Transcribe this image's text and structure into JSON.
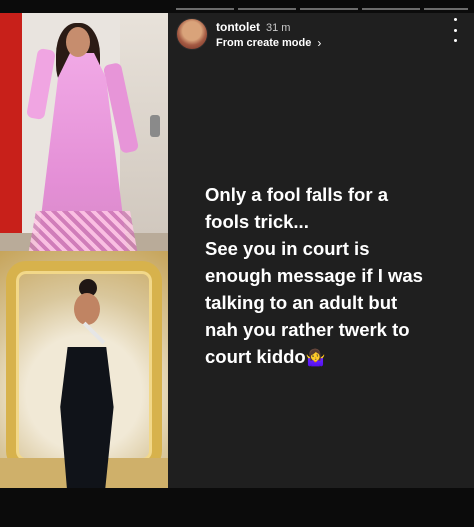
{
  "story": {
    "username": "tontolet",
    "time_ago": "31 m",
    "source_label": "From create mode",
    "source_chevron_icon": "chevron-right-icon",
    "more_menu_icon": "more-vertical-icon",
    "caption_lines": [
      "Only a fool falls for a",
      "fools trick...",
      "See you in court is",
      "enough message if I was",
      "talking to an adult but",
      "nah you rather twerk to",
      "court kiddo"
    ],
    "caption_emoji": "🤷‍♀️"
  },
  "colors": {
    "story_background": "#1f1f1f",
    "page_background": "#0b0b0b",
    "text": "#ffffff",
    "secondary_text": "#c8c8c8",
    "progress_segment": "#6c6c6c"
  },
  "photos": [
    {
      "name": "photo-pink-lace-gown"
    },
    {
      "name": "photo-black-gown-gold-frame"
    }
  ]
}
